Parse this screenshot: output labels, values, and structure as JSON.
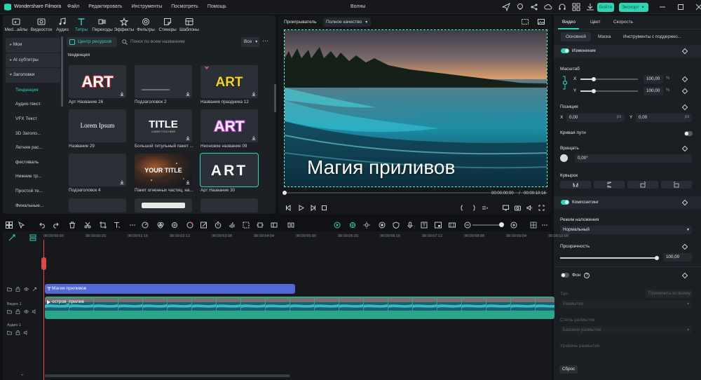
{
  "app": {
    "name": "Wondershare Filmora",
    "project_title": "Волны"
  },
  "menu": [
    "Файл",
    "Редактировать",
    "Инструменты",
    "Посмотреть",
    "Помощь"
  ],
  "header": {
    "login": "Войти",
    "export": "Экспорт"
  },
  "media_tabs": [
    {
      "label": "Med...айлы",
      "icon": "media-icon"
    },
    {
      "label": "Видеосток",
      "icon": "stock-icon"
    },
    {
      "label": "Аудио",
      "icon": "music-icon"
    },
    {
      "label": "Титры",
      "icon": "title-icon",
      "active": true
    },
    {
      "label": "Переходы",
      "icon": "transition-icon"
    },
    {
      "label": "Эффекты",
      "icon": "effects-icon"
    },
    {
      "label": "Фильтры",
      "icon": "filter-icon"
    },
    {
      "label": "Стикеры",
      "icon": "sticker-icon"
    },
    {
      "label": "Шаблоны",
      "icon": "template-icon"
    }
  ],
  "sidebar": [
    {
      "label": "Мои",
      "section": true
    },
    {
      "label": "AI субтитры",
      "section": true
    },
    {
      "label": "Заголовки",
      "section": true,
      "open": true
    },
    {
      "label": "Тенденция",
      "selected": true
    },
    {
      "label": "Аудио-текст"
    },
    {
      "label": "VFX Текст"
    },
    {
      "label": "3D Заголо..."
    },
    {
      "label": "Летняя рас..."
    },
    {
      "label": "фестиваль"
    },
    {
      "label": "Нижние тр..."
    },
    {
      "label": "Простой те..."
    },
    {
      "label": "Финальные..."
    }
  ],
  "library": {
    "resource_center": "Центр ресурсов",
    "search_placeholder": "Поиск по всем названиям",
    "filter": "Все",
    "section_title": "тенденция",
    "cards": [
      {
        "caption": "Арт Название 26",
        "preview": "ART"
      },
      {
        "caption": "Подзаголовок 2",
        "preview": ""
      },
      {
        "caption": "Название праздника 12",
        "preview": "ART"
      },
      {
        "caption": "Название 29",
        "preview": "Lorem Ipsum"
      },
      {
        "caption": "Большой титульный пакет ...",
        "preview": "TITLE",
        "preview_sub": "LOWER TITLE HERE"
      },
      {
        "caption": "Неоновое название 09",
        "preview": "ART"
      },
      {
        "caption": "Подзаголовок 4",
        "preview": ""
      },
      {
        "caption": "Пакет огненных частиц, на...",
        "preview": "YOUR TITLE"
      },
      {
        "caption": "Арт Название 30",
        "preview": "ART",
        "selected": true
      }
    ]
  },
  "player": {
    "label": "Проигрыватель",
    "quality": "Полное качество",
    "caption": "Магия приливов",
    "current_time": "00:00:00:00",
    "separator": "/",
    "total_time": "00:00:10:16"
  },
  "properties": {
    "tabs": [
      "Видео",
      "Цвет",
      "Скорость"
    ],
    "subtabs": [
      "Основной",
      "Маска",
      "Инструменты с поддержко..."
    ],
    "transform": "Изменения",
    "scale": "Масштаб",
    "x_label": "X",
    "y_label": "Y",
    "scale_x": "100,00",
    "scale_y": "100,00",
    "percent": "%",
    "position": "Позиция",
    "pos_x": "0,00",
    "pos_y": "0,00",
    "px": "px",
    "path_curve": "Кривая пути",
    "rotate": "Вращать",
    "rotate_value": "0,00°",
    "flip": "Кувырок",
    "compositing": "Композитинг",
    "blend_mode": "Режим наложения",
    "blend_value": "Нормальный",
    "opacity": "Прозрачность",
    "opacity_value": "100,00",
    "opacity_level": 1.0,
    "background": "Фон",
    "type": "Тип",
    "apply_all": "Применить ко всему",
    "blur_type": "Размытие",
    "blur_style": "Стиль размытия",
    "blur_style_value": "Базовое размытие",
    "blur_level": "Уровень размытия",
    "reset": "Сброс"
  },
  "timeline": {
    "ruler": [
      "00:00:00:00",
      "00:00:00:20",
      "00:00:01:16",
      "00:00:02:12",
      "00:00:03:08",
      "00:00:04:04",
      "00:00:05:00",
      "00:00:05:20",
      "00:00:06:16",
      "00:00:07:12",
      "00:00:08:08",
      "00:00:09:04",
      "00:00:10:00"
    ],
    "title_clip": "Магия приливов",
    "video_clip": "остров_прилив",
    "video_track": "Видео 1",
    "audio_track": "Аудио 1"
  },
  "colors": {
    "accent": "#2fd3b6",
    "title_clip": "#5566d6",
    "video_clip": "#2aa68c",
    "playhead": "#e24848"
  }
}
